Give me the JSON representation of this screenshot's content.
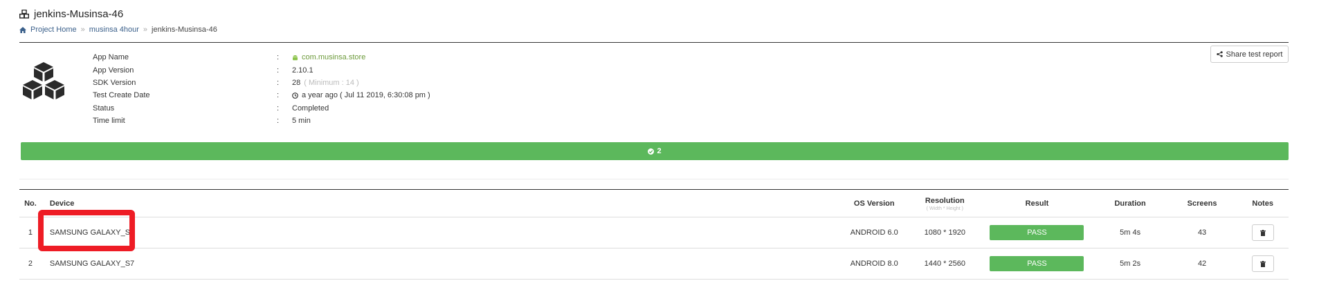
{
  "header": {
    "title": "jenkins-Musinsa-46",
    "breadcrumb": [
      {
        "label": "Project Home"
      },
      {
        "label": "musinsa 4hour"
      },
      {
        "label": "jenkins-Musinsa-46"
      }
    ]
  },
  "info": {
    "rows": [
      {
        "label": "App Name",
        "value": "com.musinsa.store",
        "extra": ""
      },
      {
        "label": "App Version",
        "value": "2.10.1",
        "extra": ""
      },
      {
        "label": "SDK Version",
        "value": "28",
        "extra": "( Minimum : 14 )"
      },
      {
        "label": "Test Create Date",
        "value": "a year ago ( Jul 11 2019, 6:30:08 pm )",
        "extra": ""
      },
      {
        "label": "Status",
        "value": "Completed",
        "extra": ""
      },
      {
        "label": "Time limit",
        "value": "5 min",
        "extra": ""
      }
    ],
    "colon": ":"
  },
  "share_button": {
    "label": "Share test report"
  },
  "progress": {
    "pass_count": "2",
    "pass_fraction": 1.0,
    "color": "#5cb85c"
  },
  "table": {
    "headers": {
      "no": "No.",
      "device": "Device",
      "os": "OS Version",
      "resolution": "Resolution",
      "resolution_sub": "( Width * Height )",
      "result": "Result",
      "duration": "Duration",
      "screens": "Screens",
      "notes": "Notes"
    },
    "rows": [
      {
        "no": "1",
        "device": "SAMSUNG GALAXY_S5",
        "os": "ANDROID 6.0",
        "resolution": "1080 * 1920",
        "result": "PASS",
        "duration": "5m 4s",
        "screens": "43"
      },
      {
        "no": "2",
        "device": "SAMSUNG GALAXY_S7",
        "os": "ANDROID 8.0",
        "resolution": "1440 * 2560",
        "result": "PASS",
        "duration": "5m 2s",
        "screens": "42"
      }
    ]
  },
  "colors": {
    "accent_green": "#5cb85c",
    "highlight_red": "#ee1c25",
    "link_blue": "#3a5f8a"
  },
  "icons": [
    "cubes-icon",
    "home-icon",
    "android-icon",
    "clock-icon",
    "share-icon",
    "check-circle-icon",
    "trash-icon"
  ]
}
